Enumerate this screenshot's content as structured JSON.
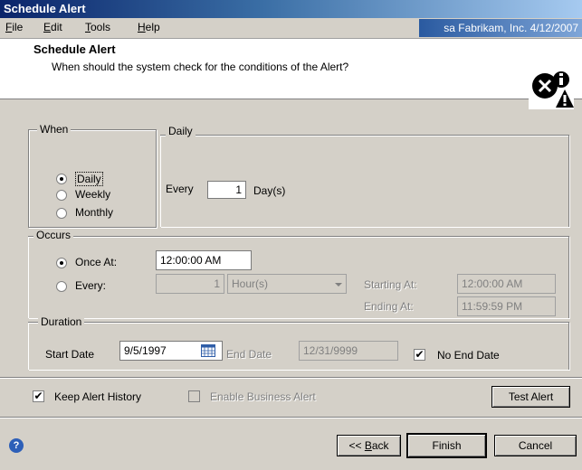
{
  "window": {
    "title": "Schedule Alert"
  },
  "menu": {
    "file": "File",
    "edit": "Edit",
    "tools": "Tools",
    "help": "Help"
  },
  "org_badge": "sa  Fabrikam, Inc.  4/12/2007",
  "header": {
    "title": "Schedule Alert",
    "subtitle": "When should the system check for the conditions of the Alert?",
    "icon": "alert-schedule-icon"
  },
  "when": {
    "label": "When",
    "options": [
      "Daily",
      "Weekly",
      "Monthly"
    ],
    "selected": "Daily"
  },
  "daily": {
    "label": "Daily",
    "every_label": "Every",
    "every_value": "1",
    "unit": "Day(s)"
  },
  "occurs": {
    "label": "Occurs",
    "once_at_label": "Once At:",
    "once_at_value": "12:00:00 AM",
    "every_label": "Every:",
    "every_value": "1",
    "every_unit": "Hour(s)",
    "starting_at_label": "Starting At:",
    "starting_at_value": "12:00:00 AM",
    "ending_at_label": "Ending At:",
    "ending_at_value": "11:59:59 PM",
    "selected": "Once At"
  },
  "duration": {
    "label": "Duration",
    "start_date_label": "Start Date",
    "start_date_value": "9/5/1997",
    "end_date_label": "End Date",
    "end_date_value": "12/31/9999",
    "no_end_date_label": "No End Date",
    "no_end_date_checked": true
  },
  "options": {
    "keep_history_label": "Keep Alert History",
    "keep_history_checked": true,
    "enable_business_label": "Enable Business Alert",
    "enable_business_checked": false
  },
  "buttons": {
    "test_alert": "Test Alert",
    "back": "<< Back",
    "finish": "Finish",
    "cancel": "Cancel"
  },
  "colors": {
    "title_bar": "#0a246a",
    "face": "#d4d0c8",
    "help_icon": "#2d5fb8"
  }
}
